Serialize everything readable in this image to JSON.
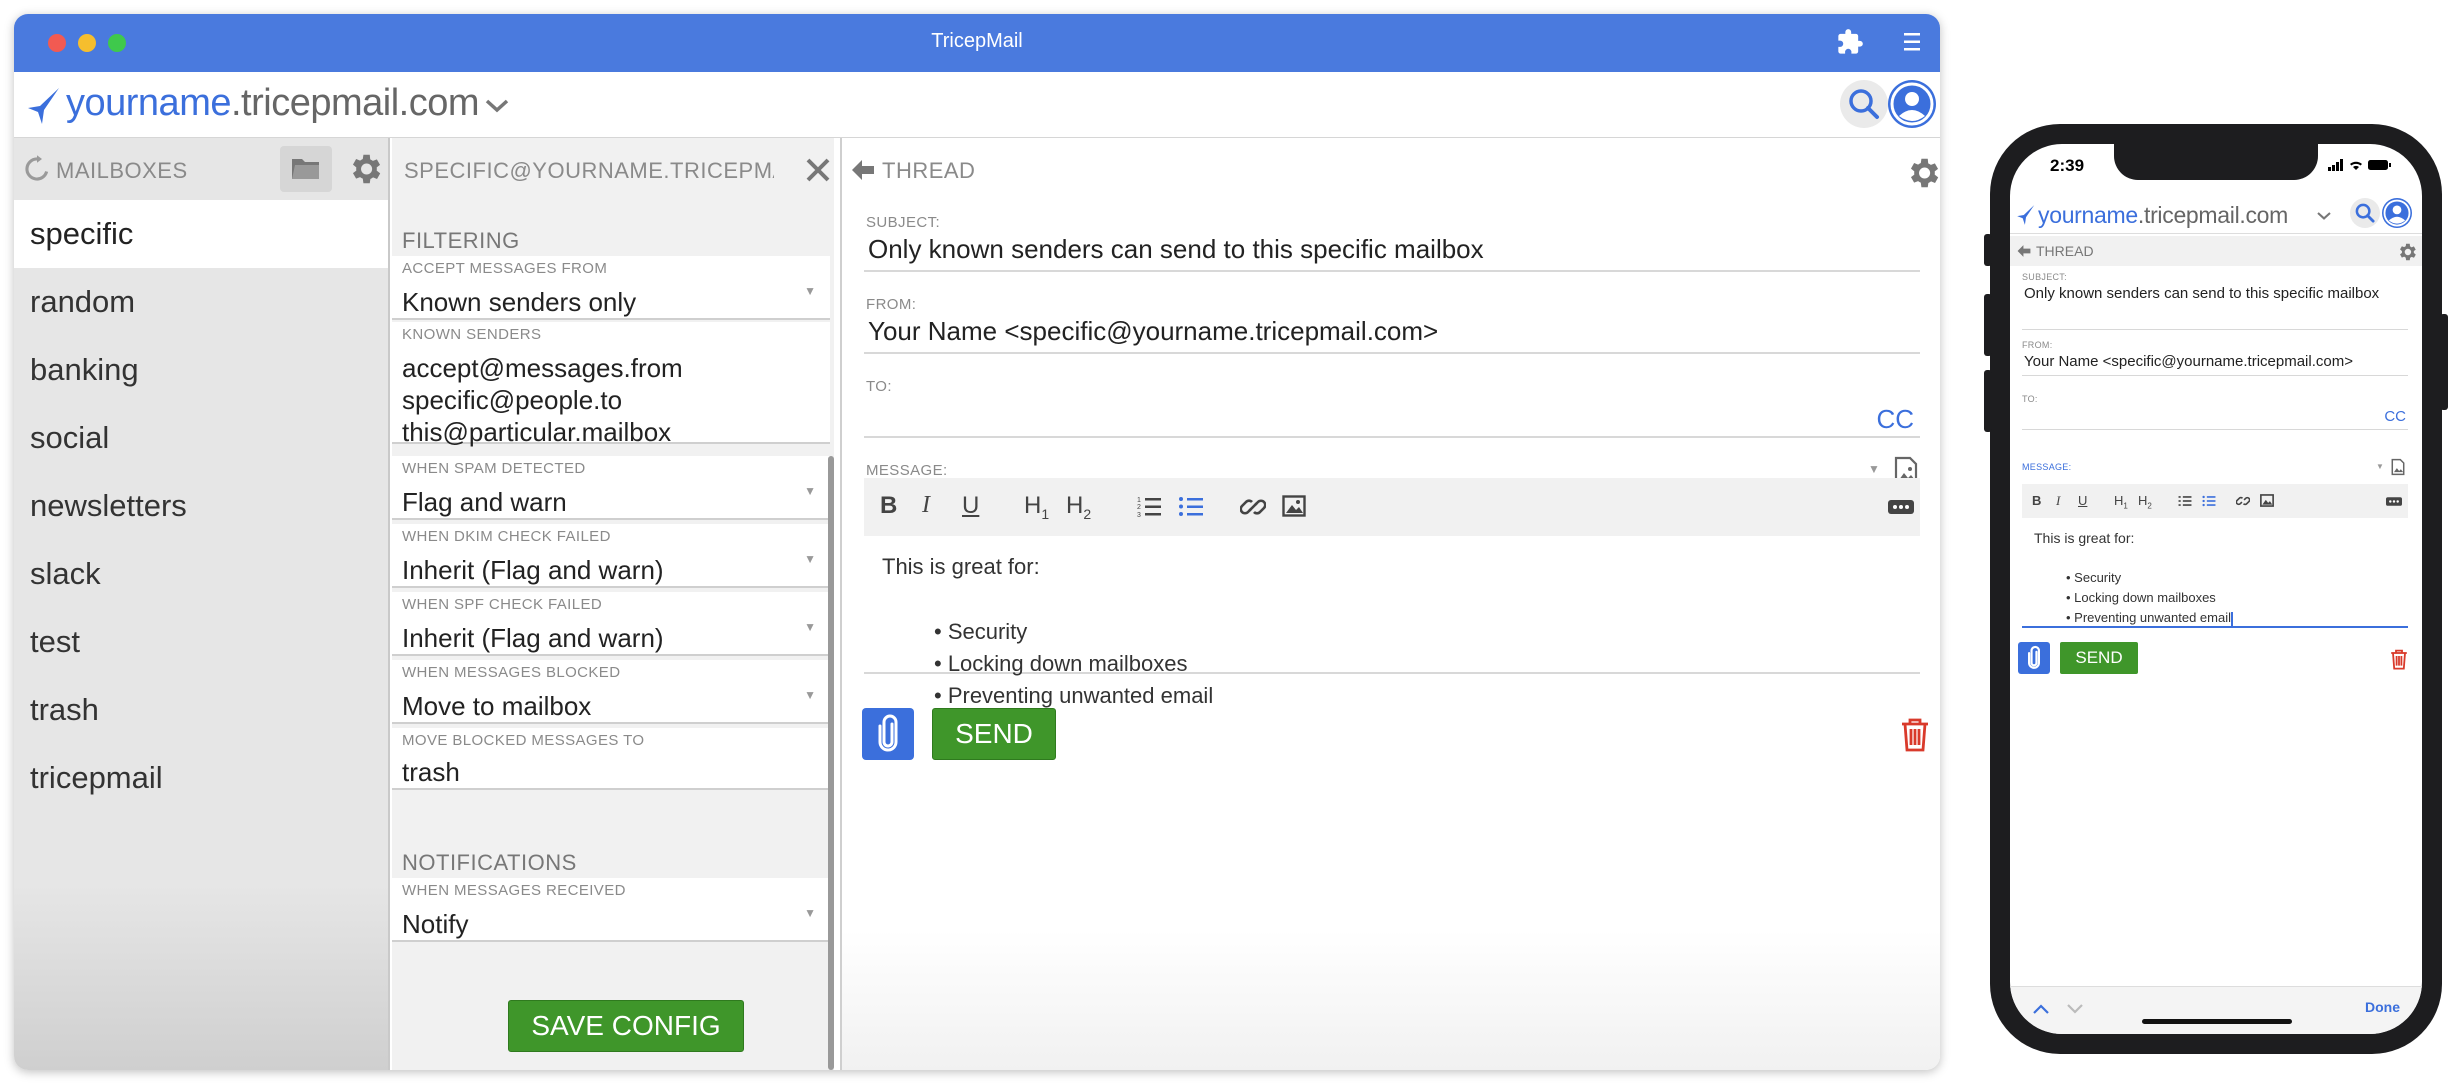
{
  "window": {
    "title": "TricepMail"
  },
  "address": {
    "domain_user": "yourname",
    "domain_rest": ".tricepmail.com"
  },
  "mailboxes": {
    "header": "MAILBOXES",
    "items": [
      "specific",
      "random",
      "banking",
      "social",
      "newsletters",
      "slack",
      "test",
      "trash",
      "tricepmail"
    ],
    "active": "specific"
  },
  "config": {
    "header": "SPECIFIC@YOURNAME.TRICEPMA",
    "filtering_label": "FILTERING",
    "fields": [
      {
        "label": "ACCEPT MESSAGES FROM",
        "value": "Known senders only"
      },
      {
        "label": "KNOWN SENDERS",
        "value": "accept@messages.from\nspecific@people.to\nthis@particular.mailbox"
      },
      {
        "label": "WHEN SPAM DETECTED",
        "value": "Flag and warn"
      },
      {
        "label": "WHEN DKIM CHECK FAILED",
        "value": "Inherit (Flag and warn)"
      },
      {
        "label": "WHEN SPF CHECK FAILED",
        "value": "Inherit (Flag and warn)"
      },
      {
        "label": "WHEN MESSAGES BLOCKED",
        "value": "Move to mailbox"
      },
      {
        "label": "MOVE BLOCKED MESSAGES TO",
        "value": "trash"
      }
    ],
    "notifications_label": "NOTIFICATIONS",
    "notify_field": {
      "label": "WHEN MESSAGES RECEIVED",
      "value": "Notify"
    },
    "save_label": "SAVE CONFIG"
  },
  "thread": {
    "header": "THREAD",
    "subject_label": "SUBJECT:",
    "subject": "Only known senders can send to this specific mailbox",
    "from_label": "FROM:",
    "from": "Your Name <specific@yourname.tricepmail.com>",
    "to_label": "TO:",
    "cc_label": "CC",
    "message_label": "MESSAGE:",
    "toolbar": {
      "bold": "B",
      "italic": "I",
      "underline": "U",
      "h1": "H",
      "h1_sub": "1",
      "h2": "H",
      "h2_sub": "2"
    },
    "body_intro": "This is great for:",
    "body_bullets": [
      "• Security",
      "• Locking down mailboxes",
      "• Preventing unwanted email"
    ],
    "send_label": "SEND"
  },
  "phone": {
    "time": "2:39",
    "header": "THREAD",
    "subject": "Only known senders can send to this specific mailbox",
    "from": "Your Name <specific@yourname.tricepmail.com>",
    "bullet_last": "• Preventing unwanted email",
    "done_label": "Done"
  },
  "colors": {
    "accent": "#3b6fdc",
    "titlebar": "#4a7ade",
    "send": "#3f962a",
    "danger": "#d93a2b"
  }
}
